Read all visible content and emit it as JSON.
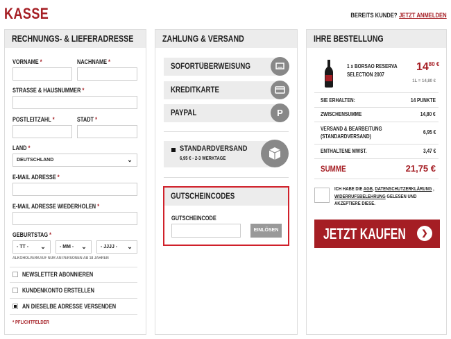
{
  "header": {
    "title": "KASSE",
    "login_prompt": "BEREITS KUNDE?",
    "login_link": "JETZT ANMELDEN"
  },
  "billing": {
    "title": "RECHNUNGS- & LIEFERADRESSE",
    "req": "*",
    "vorname": "VORNAME",
    "nachname": "NACHNAME",
    "strasse": "STRASSE & HAUSNUMMER",
    "plz": "POSTLEITZAHL",
    "stadt": "STADT",
    "land": "LAND",
    "land_value": "DEUTSCHLAND",
    "email": "E-MAIL ADRESSE",
    "email_repeat": "E-MAIL ADRESSE WIEDERHOLEN",
    "birthday": "GEBURTSTAG",
    "day": "- TT -",
    "month": "- MM -",
    "year": "- JJJJ -",
    "age_note": "ALKOHOLVERKAUF NUR AN PERSONEN AB 18 JAHREN",
    "newsletter": "NEWSLETTER ABONNIEREN",
    "account": "KUNDENKONTO ERSTELLEN",
    "same_address": "AN DIESELBE ADRESSE VERSENDEN",
    "required_note": "* PFLICHTFELDER"
  },
  "payment": {
    "title": "ZAHLUNG & VERSAND",
    "options": [
      "SOFORTÜBERWEISUNG",
      "KREDITKARTE",
      "PAYPAL"
    ],
    "paypal_glyph": "P",
    "shipping_name": "STANDARDVERSAND",
    "shipping_detail": "6,95 € - 2-3 WERKTAGE",
    "voucher_title": "GUTSCHEINCODES",
    "voucher_label": "GUTSCHEINCODE",
    "voucher_button": "EINLÖSEN"
  },
  "order": {
    "title": "IHRE BESTELLUNG",
    "item_name_1": "1 x BORSAO RESERVA",
    "item_name_2": "SELECTION 2007",
    "item_price_main": "14",
    "item_price_cents": "80 €",
    "item_unit": "1L = 14,80 €",
    "rows": [
      {
        "k": "SIE ERHALTEN:",
        "v": "14 PUNKTE"
      },
      {
        "k": "ZWISCHENSUMME",
        "v": "14,80 €"
      },
      {
        "k": "VERSAND & BEARBEITUNG",
        "k2": "(STANDARDVERSAND)",
        "v": "6,95 €"
      },
      {
        "k": "ENTHALTENE MWST.",
        "v": "3,47 €"
      }
    ],
    "sum_label": "SUMME",
    "sum_value": "21,75 €",
    "terms_1": "ICH HABE DIE",
    "terms_agb": "AGB",
    "terms_comma": ",",
    "terms_privacy": "DATENSCHUTZERKLÄRUNG",
    "terms_comma2": ",",
    "terms_revocation": "WIDERRUFSBELEHRUNG",
    "terms_2": "GELESEN UND",
    "terms_3": "AKZEPTIERE DIESE.",
    "buy_button": "JETZT KAUFEN",
    "buy_icon": "❯"
  },
  "colors": {
    "accent": "#a51e24",
    "highlight_border": "#d0202a",
    "panel": "#ececec"
  }
}
